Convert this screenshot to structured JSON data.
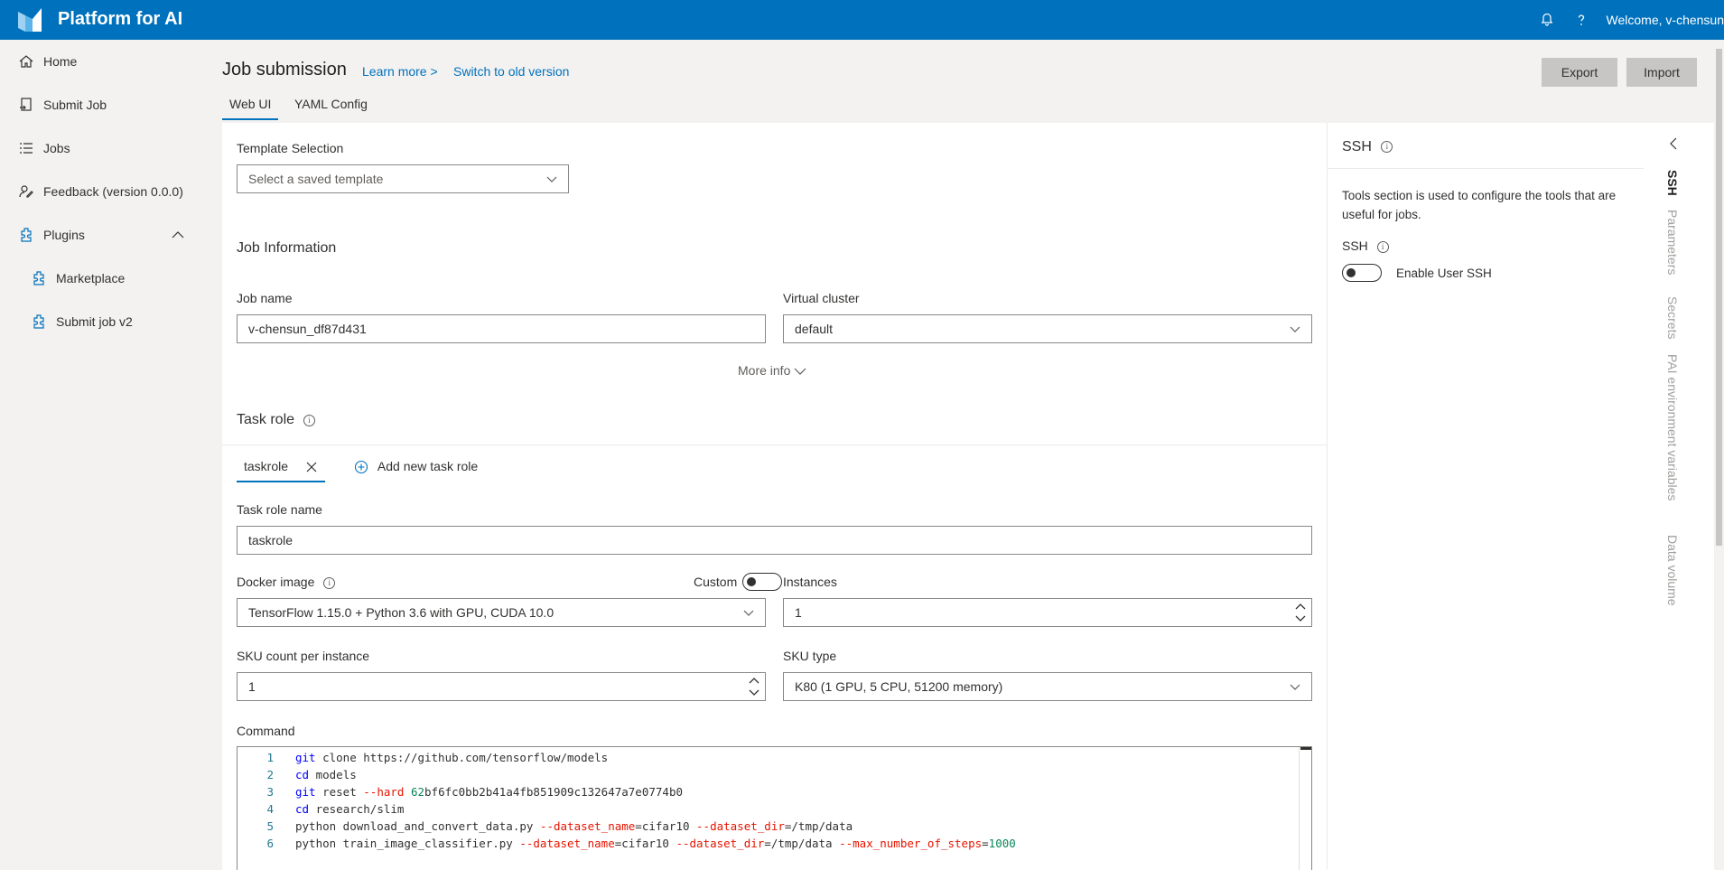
{
  "app": {
    "title": "Platform for AI",
    "welcome": "Welcome, v-chensun"
  },
  "sidebar": {
    "items": [
      {
        "label": "Home",
        "icon": "home-icon"
      },
      {
        "label": "Submit Job",
        "icon": "submit-icon"
      },
      {
        "label": "Jobs",
        "icon": "list-icon"
      },
      {
        "label": "Feedback (version 0.0.0)",
        "icon": "feedback-icon"
      },
      {
        "label": "Plugins",
        "icon": "plugin-icon"
      },
      {
        "label": "Marketplace",
        "icon": "plugin-icon"
      },
      {
        "label": "Submit job v2",
        "icon": "plugin-icon"
      }
    ]
  },
  "header": {
    "title": "Job submission",
    "learn_more": "Learn more >",
    "switch_old": "Switch to old version",
    "export": "Export",
    "import": "Import",
    "tabs": [
      "Web UI",
      "YAML Config"
    ]
  },
  "form": {
    "template_label": "Template Selection",
    "template_placeholder": "Select a saved template",
    "job_info_title": "Job Information",
    "job_name_label": "Job name",
    "job_name_value": "v-chensun_df87d431",
    "vc_label": "Virtual cluster",
    "vc_value": "default",
    "more_info": "More info",
    "task_role_title": "Task role",
    "task_role_tab": "taskrole",
    "add_task_role": "Add new task role",
    "task_role_name_label": "Task role name",
    "task_role_name_value": "taskrole",
    "docker_label": "Docker image",
    "custom_label": "Custom",
    "docker_value": "TensorFlow 1.15.0 + Python 3.6 with GPU, CUDA 10.0",
    "instances_label": "Instances",
    "instances_value": "1",
    "sku_count_label": "SKU count per instance",
    "sku_count_value": "1",
    "sku_type_label": "SKU type",
    "sku_type_value": "K80 (1 GPU, 5 CPU, 51200 memory)",
    "command_label": "Command"
  },
  "command_lines": [
    {
      "n": "1",
      "parts": [
        [
          "kw",
          "git"
        ],
        [
          "t",
          " clone https://github.com/tensorflow/models"
        ]
      ]
    },
    {
      "n": "2",
      "parts": [
        [
          "kw",
          "cd"
        ],
        [
          "t",
          " models"
        ]
      ]
    },
    {
      "n": "3",
      "parts": [
        [
          "kw",
          "git"
        ],
        [
          "t",
          " reset "
        ],
        [
          "flag",
          "--hard"
        ],
        [
          "t",
          " "
        ],
        [
          "num",
          "62"
        ],
        [
          "t",
          "bf6fc0bb2b41a4fb851909c132647a7e0774b0"
        ]
      ]
    },
    {
      "n": "4",
      "parts": [
        [
          "kw",
          "cd"
        ],
        [
          "t",
          " research/slim"
        ]
      ]
    },
    {
      "n": "5",
      "parts": [
        [
          "t",
          "python download_and_convert_data.py "
        ],
        [
          "flag",
          "--dataset_name"
        ],
        [
          "t",
          "=cifar10 "
        ],
        [
          "flag",
          "--dataset_dir"
        ],
        [
          "t",
          "=/tmp/data"
        ]
      ]
    },
    {
      "n": "6",
      "parts": [
        [
          "t",
          "python train_image_classifier.py "
        ],
        [
          "flag",
          "--dataset_name"
        ],
        [
          "t",
          "=cifar10 "
        ],
        [
          "flag",
          "--dataset_dir"
        ],
        [
          "t",
          "=/tmp/data "
        ],
        [
          "flag",
          "--max_number_of_steps"
        ],
        [
          "t",
          "="
        ],
        [
          "num",
          "1000"
        ]
      ]
    }
  ],
  "right_panel": {
    "title": "SSH",
    "description": "Tools section is used to configure the tools that are useful for jobs.",
    "ssh_label": "SSH",
    "enable_ssh": "Enable User SSH",
    "vtabs": [
      "SSH",
      "Parameters",
      "Secrets",
      "PAI environment variables",
      "Data volume"
    ]
  },
  "colors": {
    "brand": "#0071bc",
    "link": "#0071bc"
  }
}
